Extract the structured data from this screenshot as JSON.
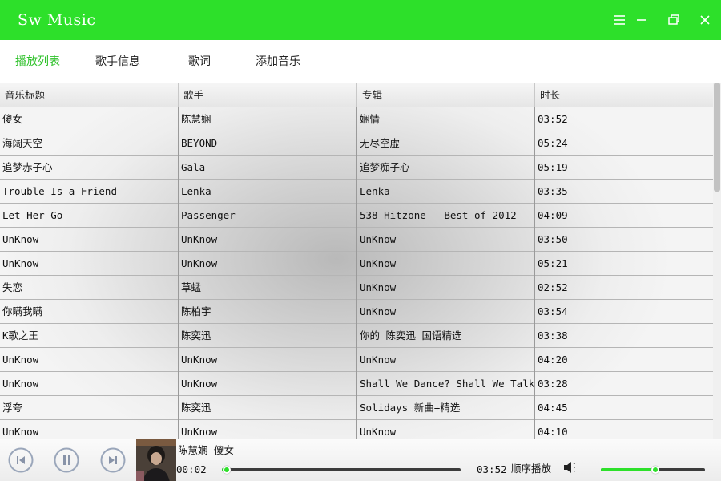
{
  "app": {
    "title": "Sw Music"
  },
  "window": {
    "menu_icon": "menu-icon",
    "minimize_icon": "minimize-icon",
    "maximize_icon": "maximize-icon",
    "close_icon": "close-icon"
  },
  "colors": {
    "accent": "#2de02a",
    "active_tab": "#2ec12a"
  },
  "tabs": [
    {
      "label": "播放列表",
      "active": true
    },
    {
      "label": "歌手信息",
      "active": false
    },
    {
      "label": "歌词",
      "active": false
    },
    {
      "label": "添加音乐",
      "active": false
    }
  ],
  "playlist": {
    "columns": [
      "音乐标题",
      "歌手",
      "专辑",
      "时长"
    ],
    "rows": [
      [
        "傻女",
        "陈慧娴",
        "娴情",
        "03:52"
      ],
      [
        "海阔天空",
        "BEYOND",
        "无尽空虚",
        "05:24"
      ],
      [
        "追梦赤子心",
        "Gala",
        "追梦痴子心",
        "05:19"
      ],
      [
        "Trouble Is a Friend",
        "Lenka",
        "Lenka",
        "03:35"
      ],
      [
        "Let Her Go",
        "Passenger",
        "538 Hitzone - Best of 2012",
        "04:09"
      ],
      [
        "UnKnow",
        "UnKnow",
        "UnKnow",
        "03:50"
      ],
      [
        "UnKnow",
        "UnKnow",
        "UnKnow",
        "05:21"
      ],
      [
        "失恋",
        "草蜢",
        "UnKnow",
        "02:52"
      ],
      [
        "你瞒我瞒",
        "陈柏宇",
        "UnKnow",
        "03:54"
      ],
      [
        "K歌之王",
        "陈奕迅",
        "你的 陈奕迅 国语精选",
        "03:38"
      ],
      [
        "UnKnow",
        "UnKnow",
        "UnKnow",
        "04:20"
      ],
      [
        "UnKnow",
        "UnKnow",
        "Shall We Dance? Shall We Talk!",
        "03:28"
      ],
      [
        "浮夸",
        "陈奕迅",
        "Solidays 新曲+精选",
        "04:45"
      ],
      [
        "UnKnow",
        "UnKnow",
        "UnKnow",
        "04:10"
      ]
    ]
  },
  "player": {
    "now_playing": "陈慧娴-傻女",
    "elapsed": "00:02",
    "duration": "03:52",
    "progress_fraction": 0.01,
    "mode": "顺序播放",
    "volume_fraction": 0.5,
    "icons": [
      "previous-icon",
      "pause-icon",
      "next-icon",
      "volume-icon"
    ]
  }
}
